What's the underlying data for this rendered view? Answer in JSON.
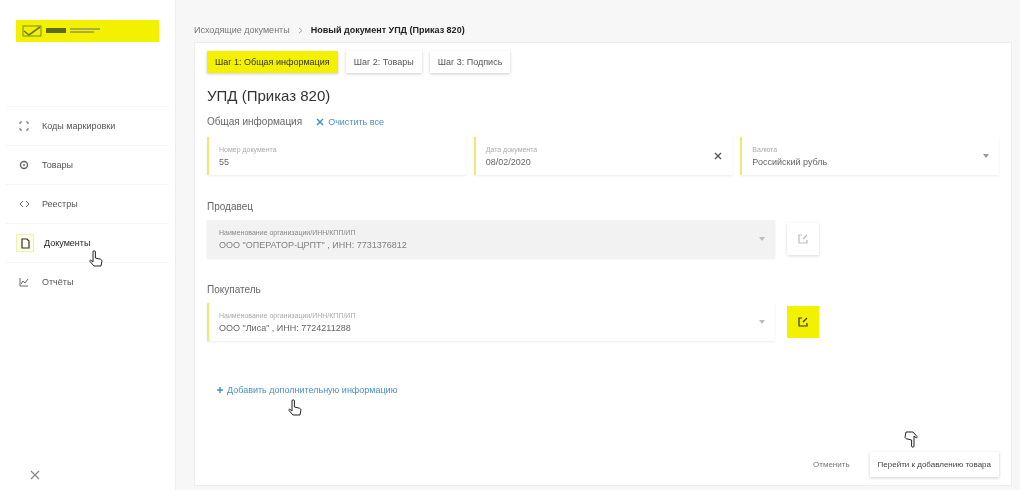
{
  "sidebar": {
    "items": [
      {
        "label": "Коды маркировки",
        "kind": "codes",
        "selected": false
      },
      {
        "label": "Товары",
        "kind": "goods",
        "selected": false
      },
      {
        "label": "Реестры",
        "kind": "registers",
        "selected": false
      },
      {
        "label": "Документы",
        "kind": "documents",
        "selected": true
      },
      {
        "label": "Отчёты",
        "kind": "reports",
        "selected": false
      }
    ]
  },
  "breadcrumb": [
    {
      "label": "Исходящие документы",
      "current": false
    },
    {
      "label": "Новый документ УПД (Приказ 820)",
      "current": true
    }
  ],
  "tabs": [
    {
      "label": "Шаг 1: Общая информация",
      "selected": true
    },
    {
      "label": "Шаг 2: Товары",
      "selected": false
    },
    {
      "label": "Шаг 3: Подпись",
      "selected": false
    }
  ],
  "title": "УПД (Приказ 820)",
  "general": {
    "heading": "Общая информация",
    "clear_link": "Очистить все",
    "fields": [
      {
        "label": "Номер документа",
        "value": "55",
        "kind": "text"
      },
      {
        "label": "Дата документа",
        "value": "08/02/2020",
        "kind": "date"
      },
      {
        "label": "Валюта",
        "value": "Российский рубль",
        "kind": "select"
      }
    ]
  },
  "parties": [
    {
      "heading": "Продавец",
      "label": "Наименование организации/ИНН/КПП/ИП",
      "value": "ООО \"ОПЕРАТОР-ЦРПТ\" , ИНН: 7731376812",
      "disabled": true
    },
    {
      "heading": "Покупатель",
      "label": "Наименование организации/ИНН/КПП/ИП",
      "value": "ООО \"Лиса\" , ИНН: 7724211288",
      "disabled": false
    }
  ],
  "add_info_link": "Добавить дополнительную информацию",
  "buttons": [
    {
      "label": "Отменить",
      "kind": "flat"
    },
    {
      "label": "Перейти к добавлению товара",
      "kind": "raised"
    }
  ]
}
